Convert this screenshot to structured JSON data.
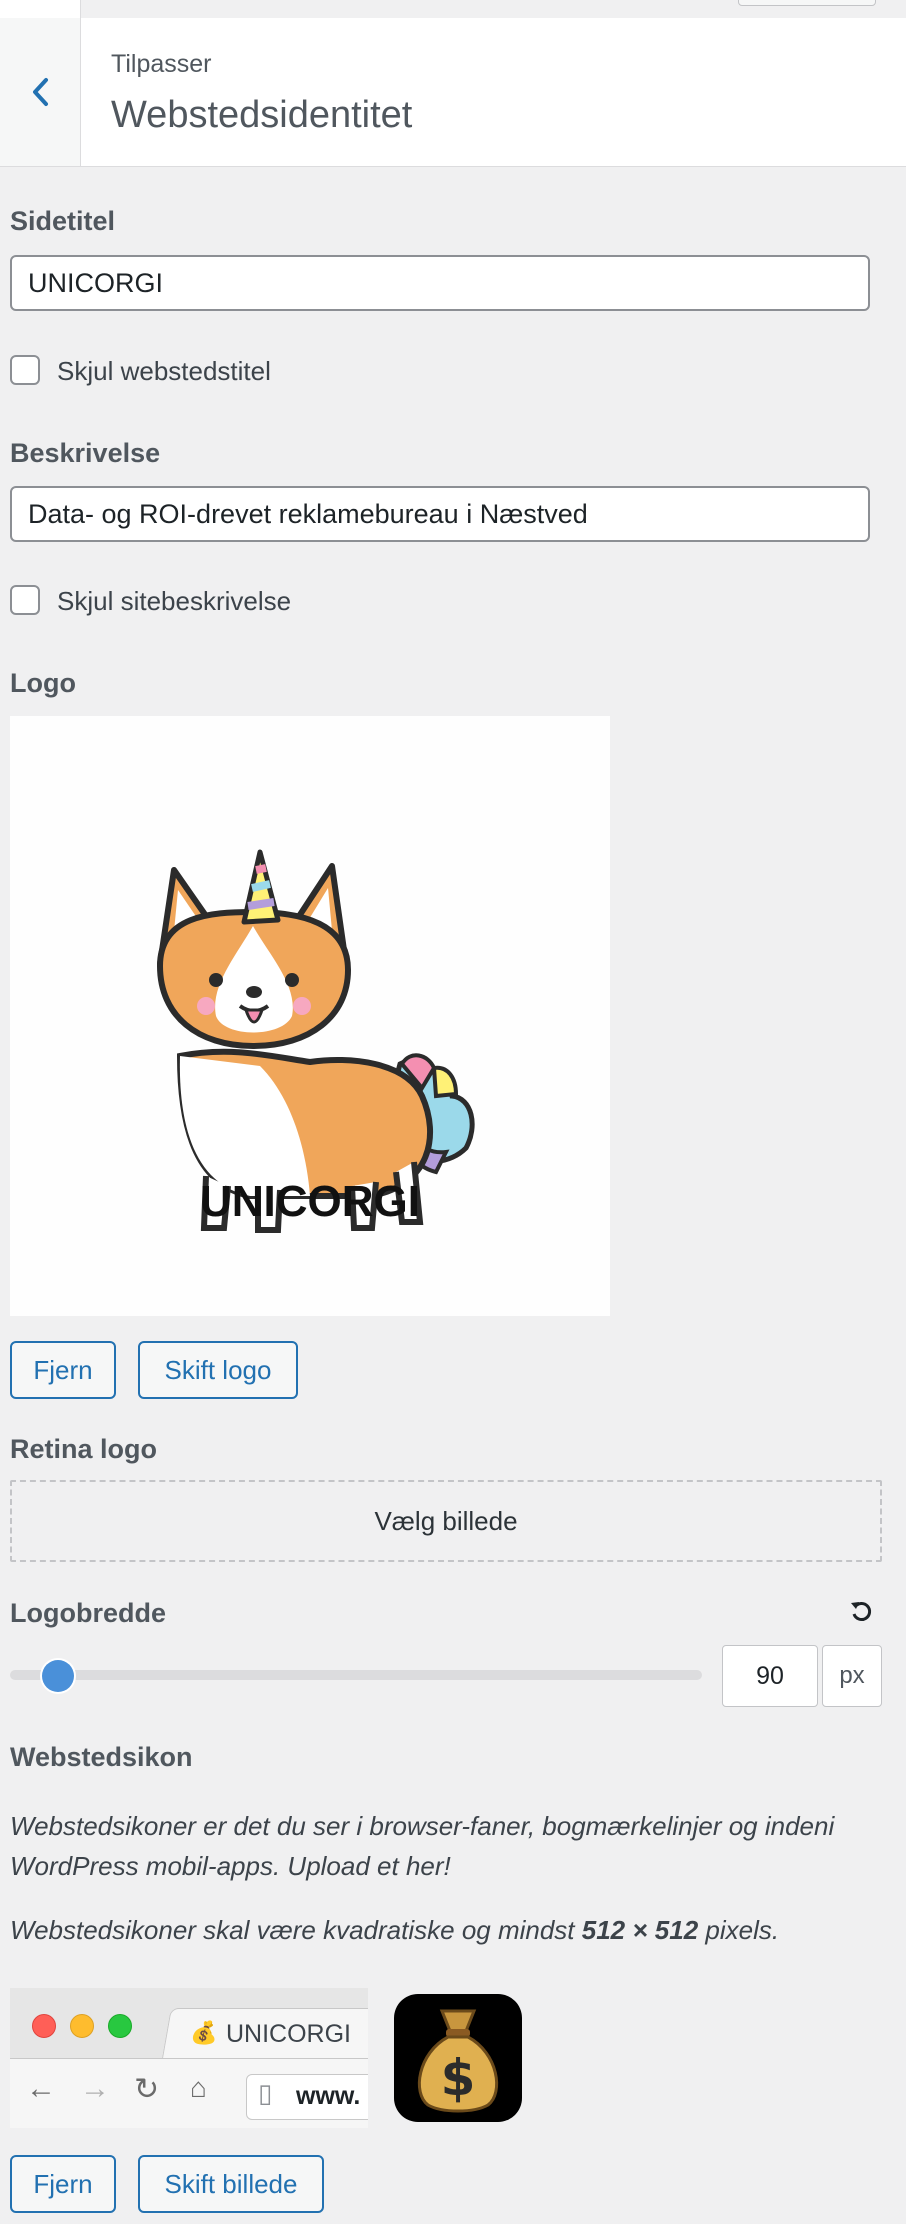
{
  "header": {
    "breadcrumb": "Tilpasser",
    "title": "Webstedsidentitet"
  },
  "site_title": {
    "label": "Sidetitel",
    "value": "UNICORGI",
    "hide_label": "Skjul webstedstitel",
    "hide_checked": false
  },
  "tagline": {
    "label": "Beskrivelse",
    "value": "Data- og ROI-drevet reklamebureau i Næstved",
    "hide_label": "Skjul sitebeskrivelse",
    "hide_checked": false
  },
  "logo": {
    "label": "Logo",
    "image_text": "UNICORGI",
    "remove_label": "Fjern",
    "change_label": "Skift logo"
  },
  "retina_logo": {
    "label": "Retina logo",
    "choose_label": "Vælg billede"
  },
  "logo_width": {
    "label": "Logobredde",
    "value": "90",
    "unit": "px",
    "reset_icon": "reset-icon"
  },
  "site_icon": {
    "label": "Webstedsikon",
    "description1": "Webstedsikoner er det du ser i browser-faner, bogmærkelinjer og indeni WordPress mobil-apps. Upload et her!",
    "description2_before": "Webstedsikoner skal være kvadratiske og mindst ",
    "description2_bold": "512 × 512",
    "description2_after": " pixels.",
    "preview_tab_title": "UNICORGI",
    "preview_url": "www.",
    "remove_label": "Fjern",
    "change_label": "Skift billede",
    "icon_name": "money-bag-icon"
  },
  "colors": {
    "accent": "#2271b1",
    "slider_thumb": "#4a90d9",
    "background": "#f0f0f1"
  }
}
